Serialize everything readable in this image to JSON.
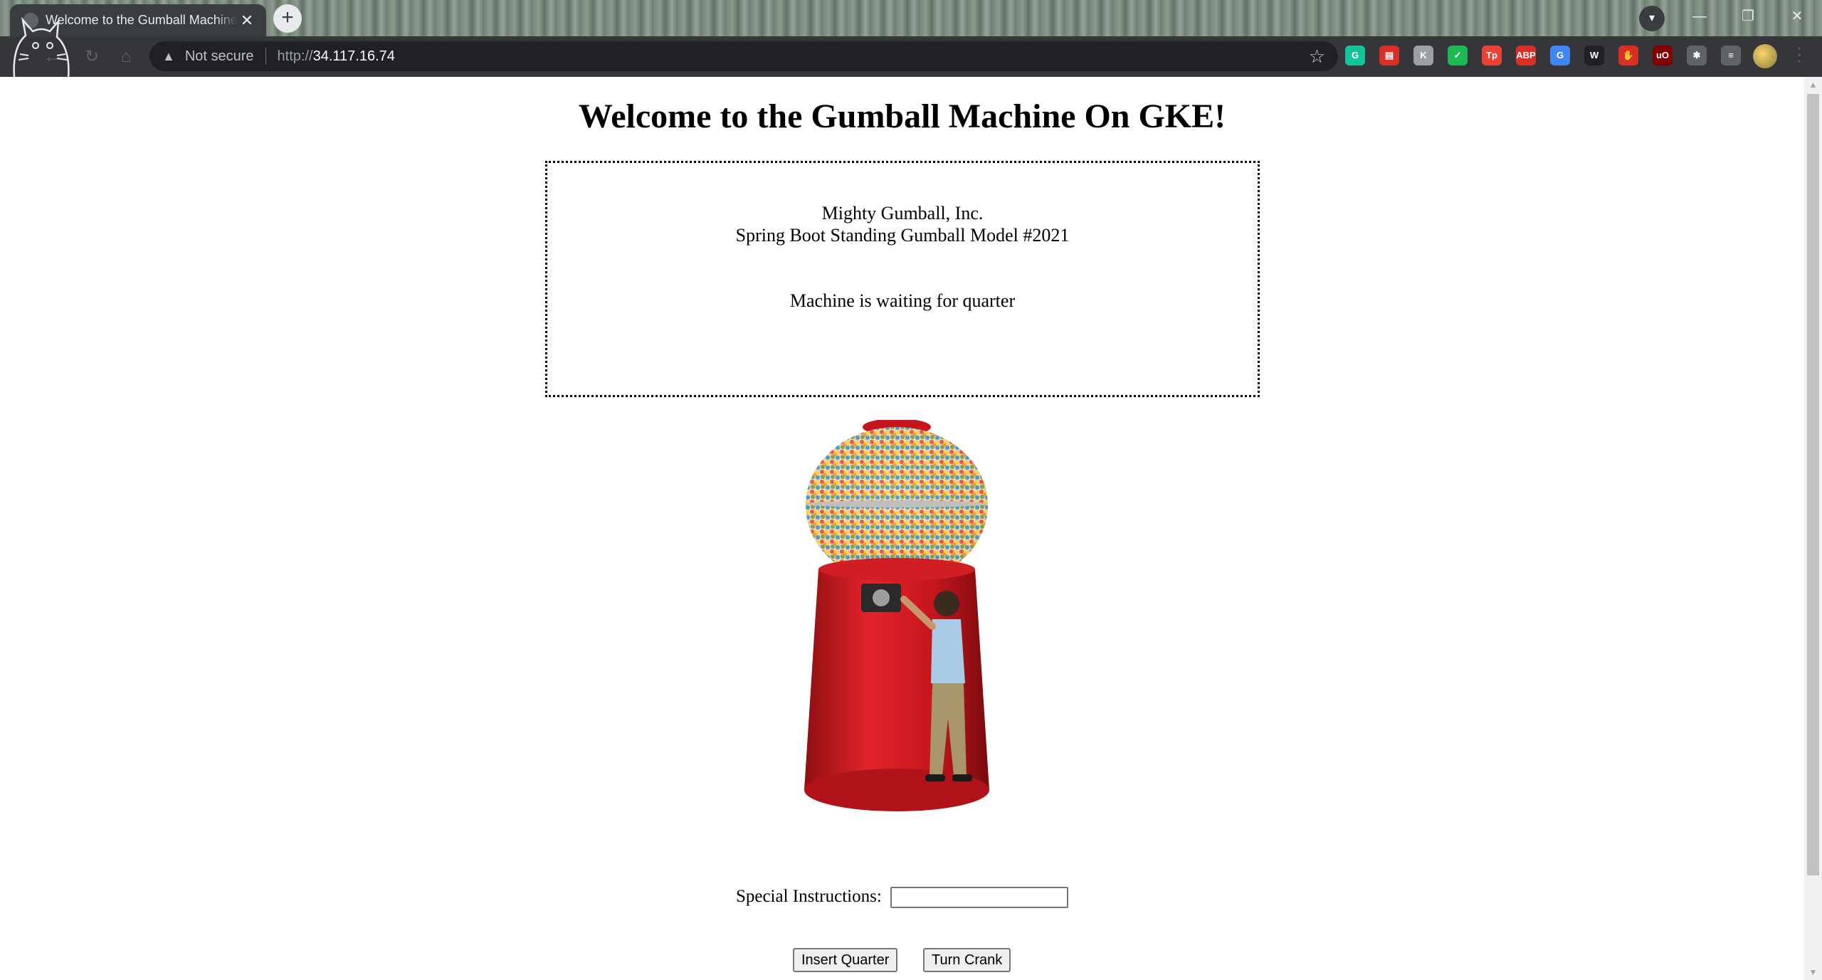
{
  "browser": {
    "tab_title": "Welcome to the Gumball Machine On GKE!",
    "tab_close": "✕",
    "new_tab": "+",
    "security_label": "Not secure",
    "url_scheme": "http://",
    "url_host": "34.117.16.74",
    "extensions": [
      {
        "name": "grammarly-icon",
        "label": "G",
        "color": "#15c39a"
      },
      {
        "name": "pdf-icon",
        "label": "▤",
        "color": "#d93025"
      },
      {
        "name": "translate-k-icon",
        "label": "K",
        "color": "#9aa0a6"
      },
      {
        "name": "save-icon",
        "label": "✓",
        "color": "#1db954"
      },
      {
        "name": "tp-icon",
        "label": "Tp",
        "color": "#ea4335"
      },
      {
        "name": "adblock-icon",
        "label": "ABP",
        "color": "#d93025"
      },
      {
        "name": "google-translate-icon",
        "label": "G",
        "color": "#4285f4"
      },
      {
        "name": "wikiwand-icon",
        "label": "W",
        "color": "#202124"
      },
      {
        "name": "hand-icon",
        "label": "✋",
        "color": "#d93025"
      },
      {
        "name": "ublock-icon",
        "label": "uO",
        "color": "#800000"
      },
      {
        "name": "extensions-puzzle-icon",
        "label": "✱",
        "color": "#5f6368"
      },
      {
        "name": "reading-list-icon",
        "label": "≡",
        "color": "#5f6368"
      }
    ]
  },
  "page": {
    "title": "Welcome to the Gumball Machine On GKE!",
    "company": "Mighty Gumball, Inc.",
    "model": "Spring Boot Standing Gumball Model #2021",
    "state": "Machine is waiting for quarter",
    "instructions_label": "Special Instructions:",
    "instructions_value": "",
    "insert_quarter_label": "Insert Quarter",
    "turn_crank_label": "Turn Crank"
  }
}
